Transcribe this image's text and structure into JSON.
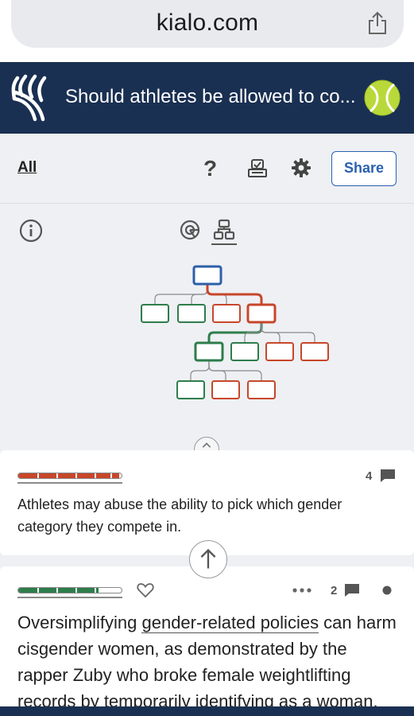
{
  "browser": {
    "url": "kialo.com",
    "share_icon": "share-icon"
  },
  "header": {
    "title": "Should athletes be allowed to co...",
    "logo_icon": "kialo-logo",
    "avatar_icon": "tennis-ball-avatar"
  },
  "toolbar": {
    "all_label": "All",
    "help_label": "?",
    "share_label": "Share"
  },
  "tree": {
    "colors": {
      "thesis": "#2c5fa8",
      "pro": "#2e7d4b",
      "con": "#c8462a"
    }
  },
  "claims": [
    {
      "text": "Athletes may abuse the ability to pick which gender category they compete in.",
      "comments": "4",
      "stance": "con",
      "bar_color": "#c8462a"
    },
    {
      "text_before": "Oversimplifying ",
      "text_link": "gender-related policies",
      "text_after": " can harm cisgender women, as demonstrated by the rapper Zuby who broke female weightlifting records by temporarily identifying as a woman.",
      "comments": "2",
      "stance": "pro",
      "bar_color": "#2e7d4b"
    }
  ]
}
